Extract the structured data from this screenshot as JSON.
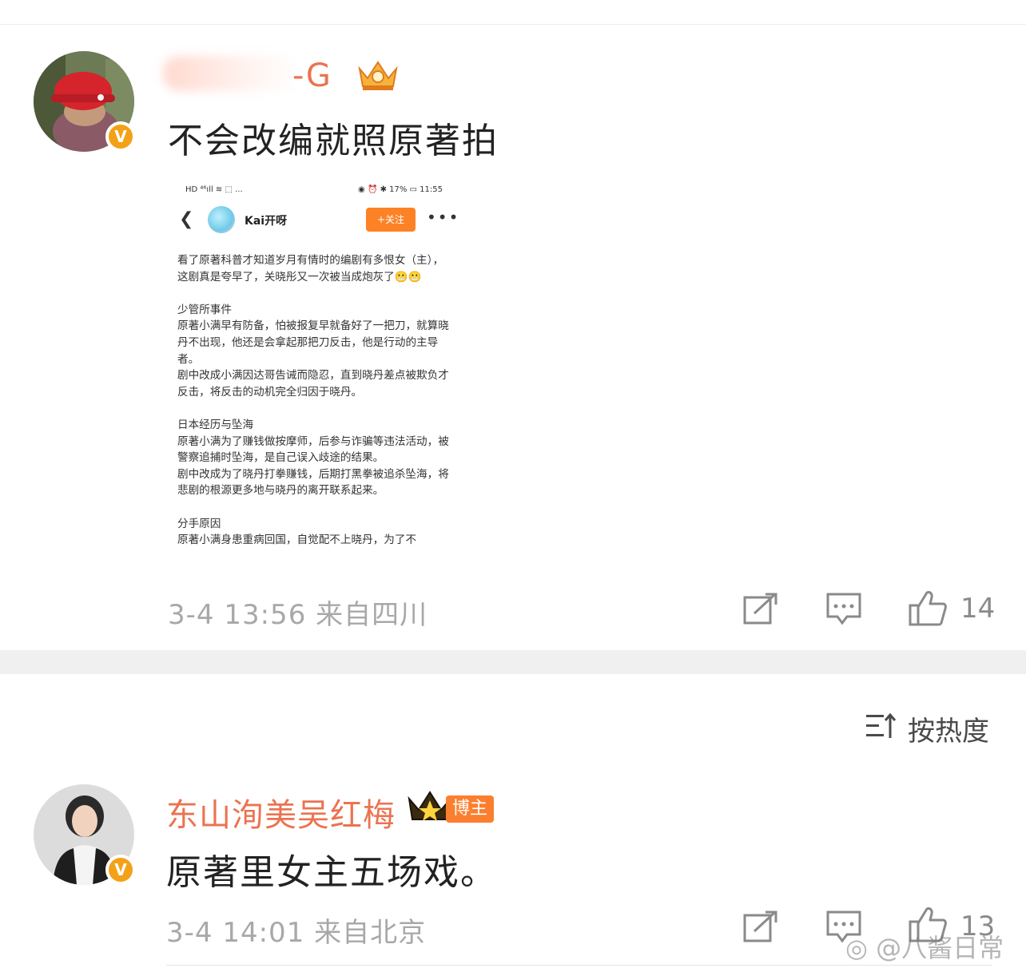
{
  "comment1": {
    "username_visible": "-G",
    "text": "不会改编就照原著拍",
    "time": "3-4 13:56",
    "location": "来自四川",
    "likes": "14",
    "avatar": "red-hat-cat-avatar",
    "badge": "crown-badge",
    "screenshot": {
      "status_left": "HD ⁴⁶ıll ≋ ⬚ ... ",
      "status_right": "◉ ⏰ ✱ 17% ▭ 11:55",
      "account": "Kai开呀",
      "follow": "+关注",
      "paragraphs": [
        "看了原著科普才知道岁月有情时的编剧有多恨女（主），这剧真是夸早了，关晓彤又一次被当成炮灰了😬😬",
        "",
        "少管所事件",
        "原著小满早有防备，怕被报复早就备好了一把刀，就算晓丹不出现，他还是会拿起那把刀反击，他是行动的主导者。",
        "剧中改成小满因达哥告诫而隐忍，直到晓丹差点被欺负才反击，将反击的动机完全归因于晓丹。",
        "",
        "日本经历与坠海",
        "原著小满为了赚钱做按摩师，后参与诈骗等违法活动，被警察追捕时坠海，是自己误入歧途的结果。",
        "剧中改成为了晓丹打拳赚钱，后期打黑拳被追杀坠海，将悲剧的根源更多地与晓丹的离开联系起来。",
        "",
        "分手原因",
        "原著小满身患重病回国，自觉配不上晓丹，为了不"
      ]
    }
  },
  "sort": {
    "label": "按热度"
  },
  "comment2": {
    "username": "东山洵美吴红梅",
    "tag": "博主",
    "text": "原著里女主五场戏。",
    "time": "3-4 14:01",
    "location": "来自北京",
    "likes": "13",
    "avatar": "woman-portrait-avatar",
    "badge": "crown-badge"
  },
  "watermark": "@八酱日常",
  "colors": {
    "username": "#eb7350",
    "verified": "#f3a116",
    "follow": "#fd8225",
    "tag": "#fb7f2f"
  }
}
